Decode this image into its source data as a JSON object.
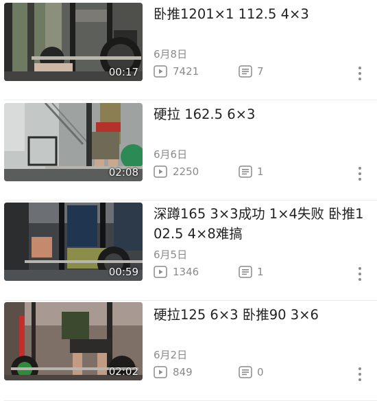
{
  "videos": [
    {
      "title": "卧推1201×1 112.5 4×3",
      "date": "6月8日",
      "views": "7421",
      "comments": "7",
      "duration": "00:17",
      "thumbnail_icon": "gym-barbell-thumbnail"
    },
    {
      "title": "硬拉 162.5 6×3",
      "date": "6月6日",
      "views": "2250",
      "comments": "1",
      "duration": "02:08",
      "thumbnail_icon": "gym-deadlift-thumbnail"
    },
    {
      "title": "深蹲165 3×3成功 1×4失败 卧推102.5 4×8难搞",
      "date": "6月5日",
      "views": "1346",
      "comments": "1",
      "duration": "00:59",
      "thumbnail_icon": "gym-squat-thumbnail"
    },
    {
      "title": "硬拉125 6×3 卧推90 3×6",
      "date": "6月2日",
      "views": "849",
      "comments": "0",
      "duration": "02:02",
      "thumbnail_icon": "gym-deadlift-thumbnail"
    }
  ],
  "icons": {
    "views": "play-count-icon",
    "comments": "comment-count-icon",
    "more": "more-vertical-icon"
  },
  "colors": {
    "title": "#222222",
    "meta": "#8a8a8a",
    "divider": "#ececec",
    "duration_text": "#ffffff"
  }
}
